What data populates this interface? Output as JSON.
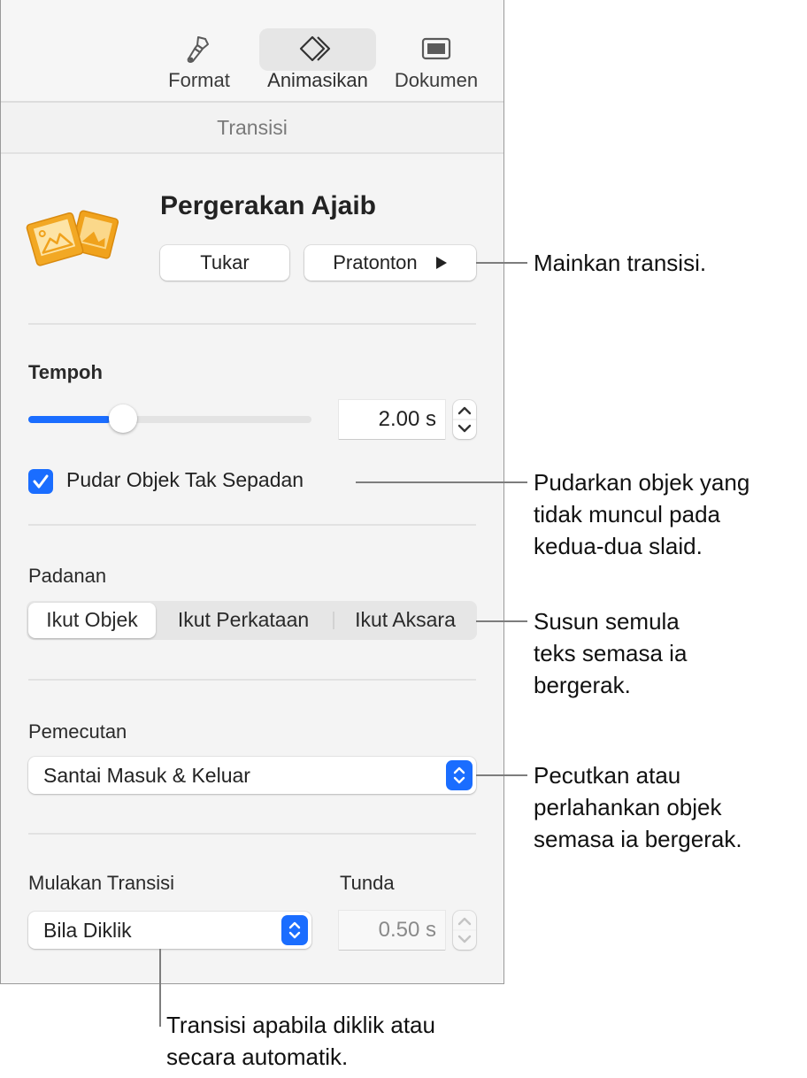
{
  "toolbar": {
    "tabs": [
      {
        "label": "Format",
        "icon": "paintbrush-icon",
        "active": false
      },
      {
        "label": "Animasikan",
        "icon": "animate-diamonds-icon",
        "active": true
      },
      {
        "label": "Dokumen",
        "icon": "document-icon",
        "active": false
      }
    ]
  },
  "section_header": "Transisi",
  "transition": {
    "name": "Pergerakan Ajaib",
    "icon": "magic-move-photos-icon",
    "icon_color": "#f0a21c",
    "change_button": "Tukar",
    "preview_button": "Pratonton",
    "preview_icon": "play-icon"
  },
  "duration": {
    "label": "Tempoh",
    "value": "2.00 s",
    "slider_fraction": 0.29
  },
  "fade_unmatched": {
    "label": "Pudar Objek Tak Sepadan",
    "checked": true
  },
  "matching": {
    "label": "Padanan",
    "options": [
      "Ikut Objek",
      "Ikut Perkataan",
      "Ikut Aksara"
    ],
    "selected": "Ikut Objek"
  },
  "acceleration": {
    "label": "Pemecutan",
    "value": "Santai Masuk & Keluar"
  },
  "start_transition": {
    "label": "Mulakan Transisi",
    "value": "Bila Diklik"
  },
  "delay": {
    "label": "Tunda",
    "value": "0.50 s",
    "enabled": false
  },
  "accent_color": "#1a6dff",
  "callouts": {
    "play": "Mainkan transisi.",
    "fade": [
      "Pudarkan objek yang",
      "tidak muncul pada",
      "kedua-dua slaid."
    ],
    "match": [
      "Susun semula",
      "teks semasa ia",
      "bergerak."
    ],
    "accel": [
      "Pecutkan atau",
      "perlahankan objek",
      "semasa ia bergerak."
    ],
    "start": [
      "Transisi apabila diklik atau",
      "secara automatik."
    ]
  }
}
